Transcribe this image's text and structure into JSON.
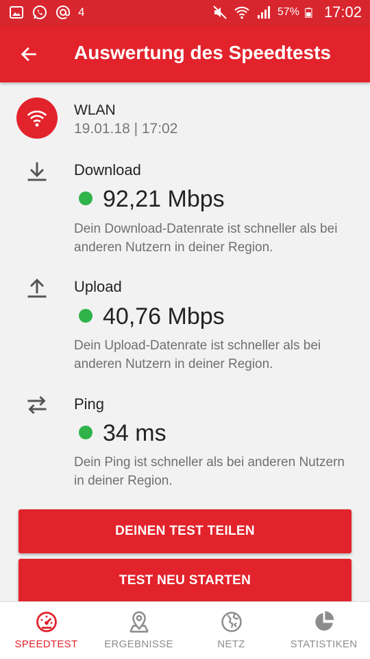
{
  "status_bar": {
    "notification_count": "4",
    "battery_percent": "57%",
    "time": "17:02",
    "left_icons": [
      "gallery-icon",
      "whatsapp-icon",
      "at-icon"
    ],
    "right_icons": [
      "mute-icon",
      "wifi-icon",
      "signal-icon",
      "battery-icon"
    ]
  },
  "header": {
    "title": "Auswertung des Speedtests",
    "back_icon": "arrow-left-icon",
    "color": "#e2232c"
  },
  "connection": {
    "type": "WLAN",
    "date": "19.01.18 | 17:02",
    "icon": "wifi-icon"
  },
  "metrics": [
    {
      "label": "Download",
      "value": "92,21 Mbps",
      "description": "Dein Download-Datenrate ist schneller als bei anderen Nutzern in deiner Region.",
      "icon": "download-icon",
      "status_color": "#2fb34a"
    },
    {
      "label": "Upload",
      "value": "40,76 Mbps",
      "description": "Dein Upload-Datenrate ist schneller als bei anderen Nutzern in deiner Region.",
      "icon": "upload-icon",
      "status_color": "#2fb34a"
    },
    {
      "label": "Ping",
      "value": "34 ms",
      "description": "Dein Ping ist schneller als bei anderen Nutzern in deiner Region.",
      "icon": "swap-arrows-icon",
      "status_color": "#2fb34a"
    }
  ],
  "actions": {
    "share_label": "DEINEN TEST TEILEN",
    "restart_label": "TEST NEU STARTEN"
  },
  "bottom_nav": {
    "active": "SPEEDTEST",
    "items": [
      {
        "label": "SPEEDTEST",
        "icon": "speedometer-icon"
      },
      {
        "label": "ERGEBNISSE",
        "icon": "map-pin-icon"
      },
      {
        "label": "NETZ",
        "icon": "network-icon"
      },
      {
        "label": "STATISTIKEN",
        "icon": "pie-chart-icon"
      }
    ]
  }
}
